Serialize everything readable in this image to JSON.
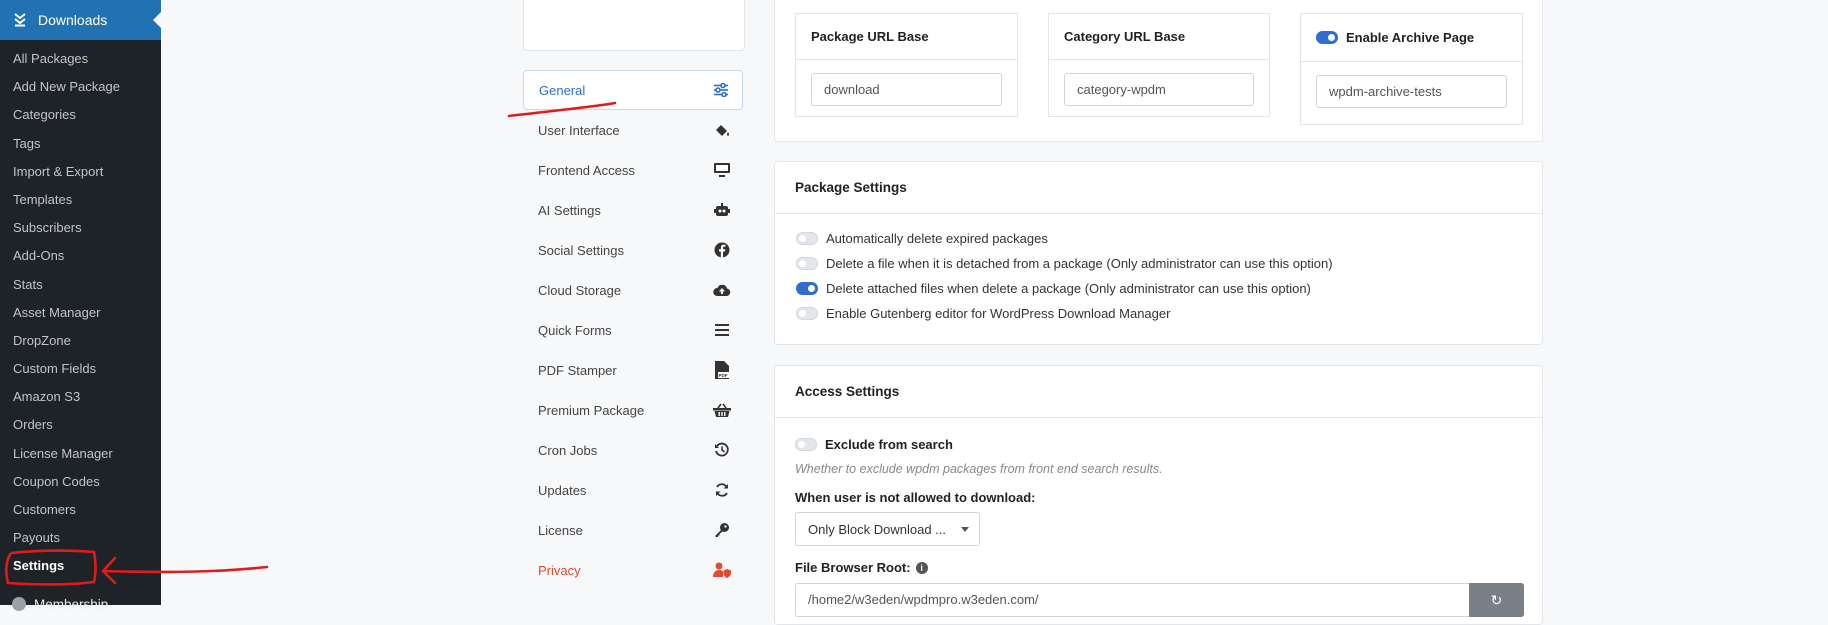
{
  "sidebar": {
    "header": {
      "label": "Downloads",
      "icon": "downloads-icon"
    },
    "items": [
      {
        "label": "All Packages"
      },
      {
        "label": "Add New Package"
      },
      {
        "label": "Categories"
      },
      {
        "label": "Tags"
      },
      {
        "label": "Import & Export"
      },
      {
        "label": "Templates"
      },
      {
        "label": "Subscribers"
      },
      {
        "label": "Add-Ons"
      },
      {
        "label": "Stats"
      },
      {
        "label": "Asset Manager"
      },
      {
        "label": "DropZone"
      },
      {
        "label": "Custom Fields"
      },
      {
        "label": "Amazon S3"
      },
      {
        "label": "Orders"
      },
      {
        "label": "License Manager"
      },
      {
        "label": "Coupon Codes"
      },
      {
        "label": "Customers"
      },
      {
        "label": "Payouts"
      },
      {
        "label": "Settings",
        "active": true
      }
    ],
    "next_menu": {
      "label": "Membership"
    }
  },
  "settings_nav": [
    {
      "label": "General",
      "icon": "sliders-icon",
      "active": true
    },
    {
      "label": "User Interface",
      "icon": "paint-bucket-icon"
    },
    {
      "label": "Frontend Access",
      "icon": "desktop-icon"
    },
    {
      "label": "AI Settings",
      "icon": "robot-icon"
    },
    {
      "label": "Social Settings",
      "icon": "facebook-icon"
    },
    {
      "label": "Cloud Storage",
      "icon": "cloud-upload-icon"
    },
    {
      "label": "Quick Forms",
      "icon": "bars-icon"
    },
    {
      "label": "PDF Stamper",
      "icon": "pdf-file-icon"
    },
    {
      "label": "Premium Package",
      "icon": "basket-icon"
    },
    {
      "label": "Cron Jobs",
      "icon": "history-icon"
    },
    {
      "label": "Updates",
      "icon": "sync-icon"
    },
    {
      "label": "License",
      "icon": "key-icon"
    },
    {
      "label": "Privacy",
      "icon": "user-shield-icon",
      "color": "#e8492d"
    }
  ],
  "url_settings": {
    "package_base": {
      "title": "Package URL Base",
      "value": "download"
    },
    "category_base": {
      "title": "Category URL Base",
      "value": "category-wpdm"
    },
    "archive_page": {
      "title": "Enable Archive Page",
      "enabled": true,
      "value": "wpdm-archive-tests"
    }
  },
  "package_settings": {
    "title": "Package Settings",
    "options": [
      {
        "label": "Automatically delete expired packages",
        "enabled": false
      },
      {
        "label": "Delete a file when it is detached from a package (Only administrator can use this option)",
        "enabled": false
      },
      {
        "label": "Delete attached files when delete a package (Only administrator can use this option)",
        "enabled": true
      },
      {
        "label": "Enable Gutenberg editor for WordPress Download Manager",
        "enabled": false
      }
    ]
  },
  "access_settings": {
    "title": "Access Settings",
    "exclude_label": "Exclude from search",
    "exclude_enabled": false,
    "exclude_hint": "Whether to exclude wpdm packages from front end search results.",
    "not_allowed_label": "When user is not allowed to download:",
    "not_allowed_value": "Only Block Download ...",
    "file_browser_label": "File Browser Root:",
    "file_browser_value": "/home2/w3eden/wpdmpro.w3eden.com/"
  },
  "colors": {
    "accent": "#2f6dd0",
    "sidebar_bg": "#1d2327",
    "sidebar_active": "#2271b1",
    "annotation": "#e01b1b",
    "privacy": "#e8492d"
  }
}
